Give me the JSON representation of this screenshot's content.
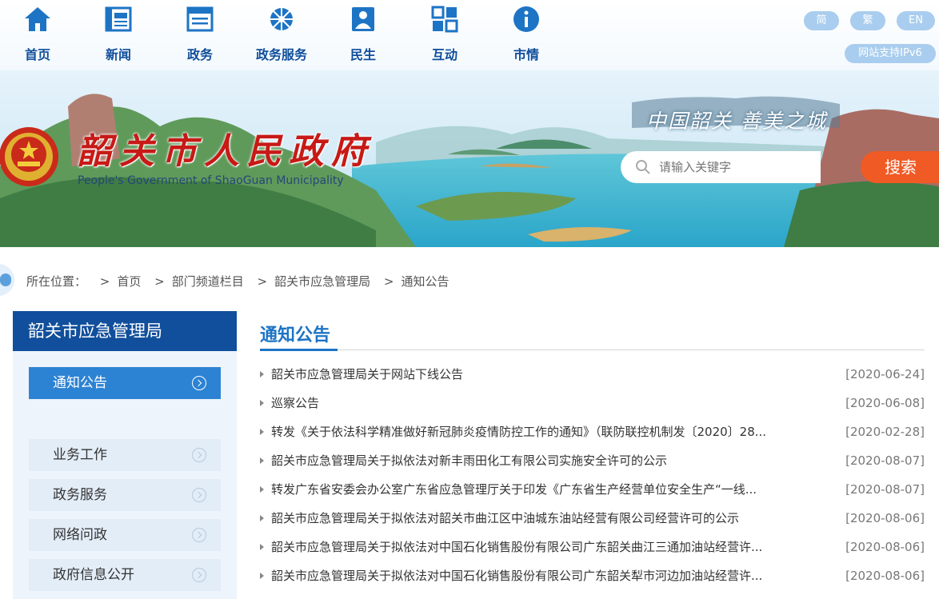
{
  "nav": {
    "items": [
      {
        "label": "首页",
        "icon": "home-icon"
      },
      {
        "label": "新闻",
        "icon": "news-icon"
      },
      {
        "label": "政务",
        "icon": "government-affairs-icon"
      },
      {
        "label": "政务服务",
        "icon": "service-icon"
      },
      {
        "label": "民生",
        "icon": "livelihood-icon"
      },
      {
        "label": "互动",
        "icon": "interaction-icon"
      },
      {
        "label": "市情",
        "icon": "info-icon"
      }
    ],
    "lang": {
      "simplified": "简",
      "traditional": "繁",
      "english": "EN"
    },
    "ipv6": "网站支持IPv6"
  },
  "banner": {
    "title": "韶关市人民政府",
    "subtitle": "People's Government of ShaoGuan Municipality",
    "slogan": "中国韶关  善美之城",
    "search_placeholder": "请输入关键字",
    "search_button": "搜索"
  },
  "breadcrumb": {
    "prefix": "所在位置：",
    "items": [
      "首页",
      "部门频道栏目",
      "韶关市应急管理局",
      "通知公告"
    ]
  },
  "sidebar": {
    "title": "韶关市应急管理局",
    "items": [
      "通知公告",
      "业务工作",
      "政务服务",
      "网络问政",
      "政府信息公开"
    ]
  },
  "main": {
    "title": "通知公告",
    "list": [
      {
        "title": "韶关市应急管理局关于网站下线公告",
        "date": "[2020-06-24]"
      },
      {
        "title": "巡察公告",
        "date": "[2020-06-08]"
      },
      {
        "title": "转发《关于依法科学精准做好新冠肺炎疫情防控工作的通知》（联防联控机制发〔2020〕28...",
        "date": "[2020-02-28]"
      },
      {
        "title": "韶关市应急管理局关于拟依法对新丰雨田化工有限公司实施安全许可的公示",
        "date": "[2020-08-07]"
      },
      {
        "title": "转发广东省安委会办公室广东省应急管理厅关于印发《广东省生产经营单位安全生产“一线...",
        "date": "[2020-08-07]"
      },
      {
        "title": "韶关市应急管理局关于拟依法对韶关市曲江区中油城东油站经营有限公司经营许可的公示",
        "date": "[2020-08-06]"
      },
      {
        "title": "韶关市应急管理局关于拟依法对中国石化销售股份有限公司广东韶关曲江三通加油站经营许...",
        "date": "[2020-08-06]"
      },
      {
        "title": "韶关市应急管理局关于拟依法对中国石化销售股份有限公司广东韶关犁市河边加油站经营许...",
        "date": "[2020-08-06]"
      }
    ]
  },
  "colors": {
    "brand_blue": "#114f9c",
    "accent_orange": "#f05a24",
    "title_red": "#c71a16",
    "link_blue": "#1d74c5"
  }
}
